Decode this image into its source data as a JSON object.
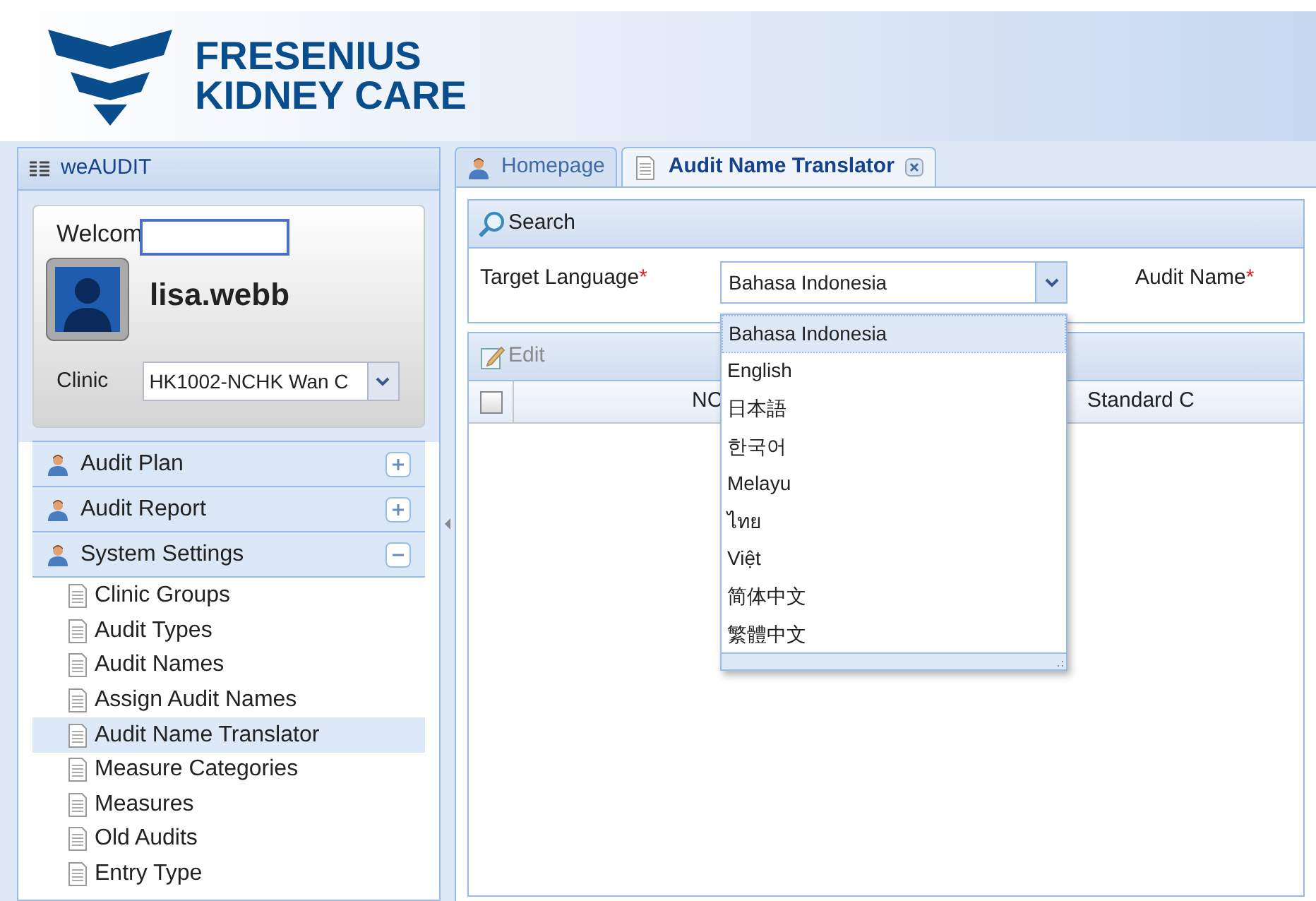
{
  "logo": {
    "line1": "FRESENIUS",
    "line2": "KIDNEY CARE"
  },
  "sidebar": {
    "title": "weAUDIT",
    "welcome": "Welcom",
    "username": "lisa.webb",
    "clinic_label": "Clinic",
    "clinic_value": "HK1002-NCHK Wan C",
    "sections": [
      {
        "label": "Audit Plan",
        "expanded": false
      },
      {
        "label": "Audit Report",
        "expanded": false
      },
      {
        "label": "System Settings",
        "expanded": true
      }
    ],
    "items": [
      {
        "label": "Clinic Groups",
        "selected": false
      },
      {
        "label": "Audit Types",
        "selected": false
      },
      {
        "label": "Audit Names",
        "selected": false
      },
      {
        "label": "Assign Audit Names",
        "selected": false
      },
      {
        "label": "Audit Name Translator",
        "selected": true
      },
      {
        "label": "Measure Categories",
        "selected": false
      },
      {
        "label": "Measures",
        "selected": false
      },
      {
        "label": "Old Audits",
        "selected": false
      },
      {
        "label": "Entry Type",
        "selected": false
      }
    ]
  },
  "tabs": [
    {
      "label": "Homepage",
      "kind": "home",
      "selected": false,
      "closable": false
    },
    {
      "label": "Audit Name Translator",
      "kind": "page",
      "selected": true,
      "closable": true
    }
  ],
  "search_panel": {
    "title": "Search",
    "target_language_label": "Target Language",
    "target_language_value": "Bahasa Indonesia",
    "audit_name_label": "Audit Name",
    "required_mark": "*"
  },
  "dropdown": [
    {
      "label": "Bahasa Indonesia",
      "selected": true
    },
    {
      "label": "English",
      "selected": false
    },
    {
      "label": "日本語",
      "selected": false
    },
    {
      "label": "한국어",
      "selected": false
    },
    {
      "label": "Melayu",
      "selected": false
    },
    {
      "label": "ไทย",
      "selected": false
    },
    {
      "label": "Việt",
      "selected": false
    },
    {
      "label": "简体中文",
      "selected": false
    },
    {
      "label": "繁體中文",
      "selected": false
    }
  ],
  "grid": {
    "edit_label": "Edit",
    "edit_disabled": true,
    "all_checked": false,
    "columns": [
      "NC",
      "Standard C"
    ]
  }
}
